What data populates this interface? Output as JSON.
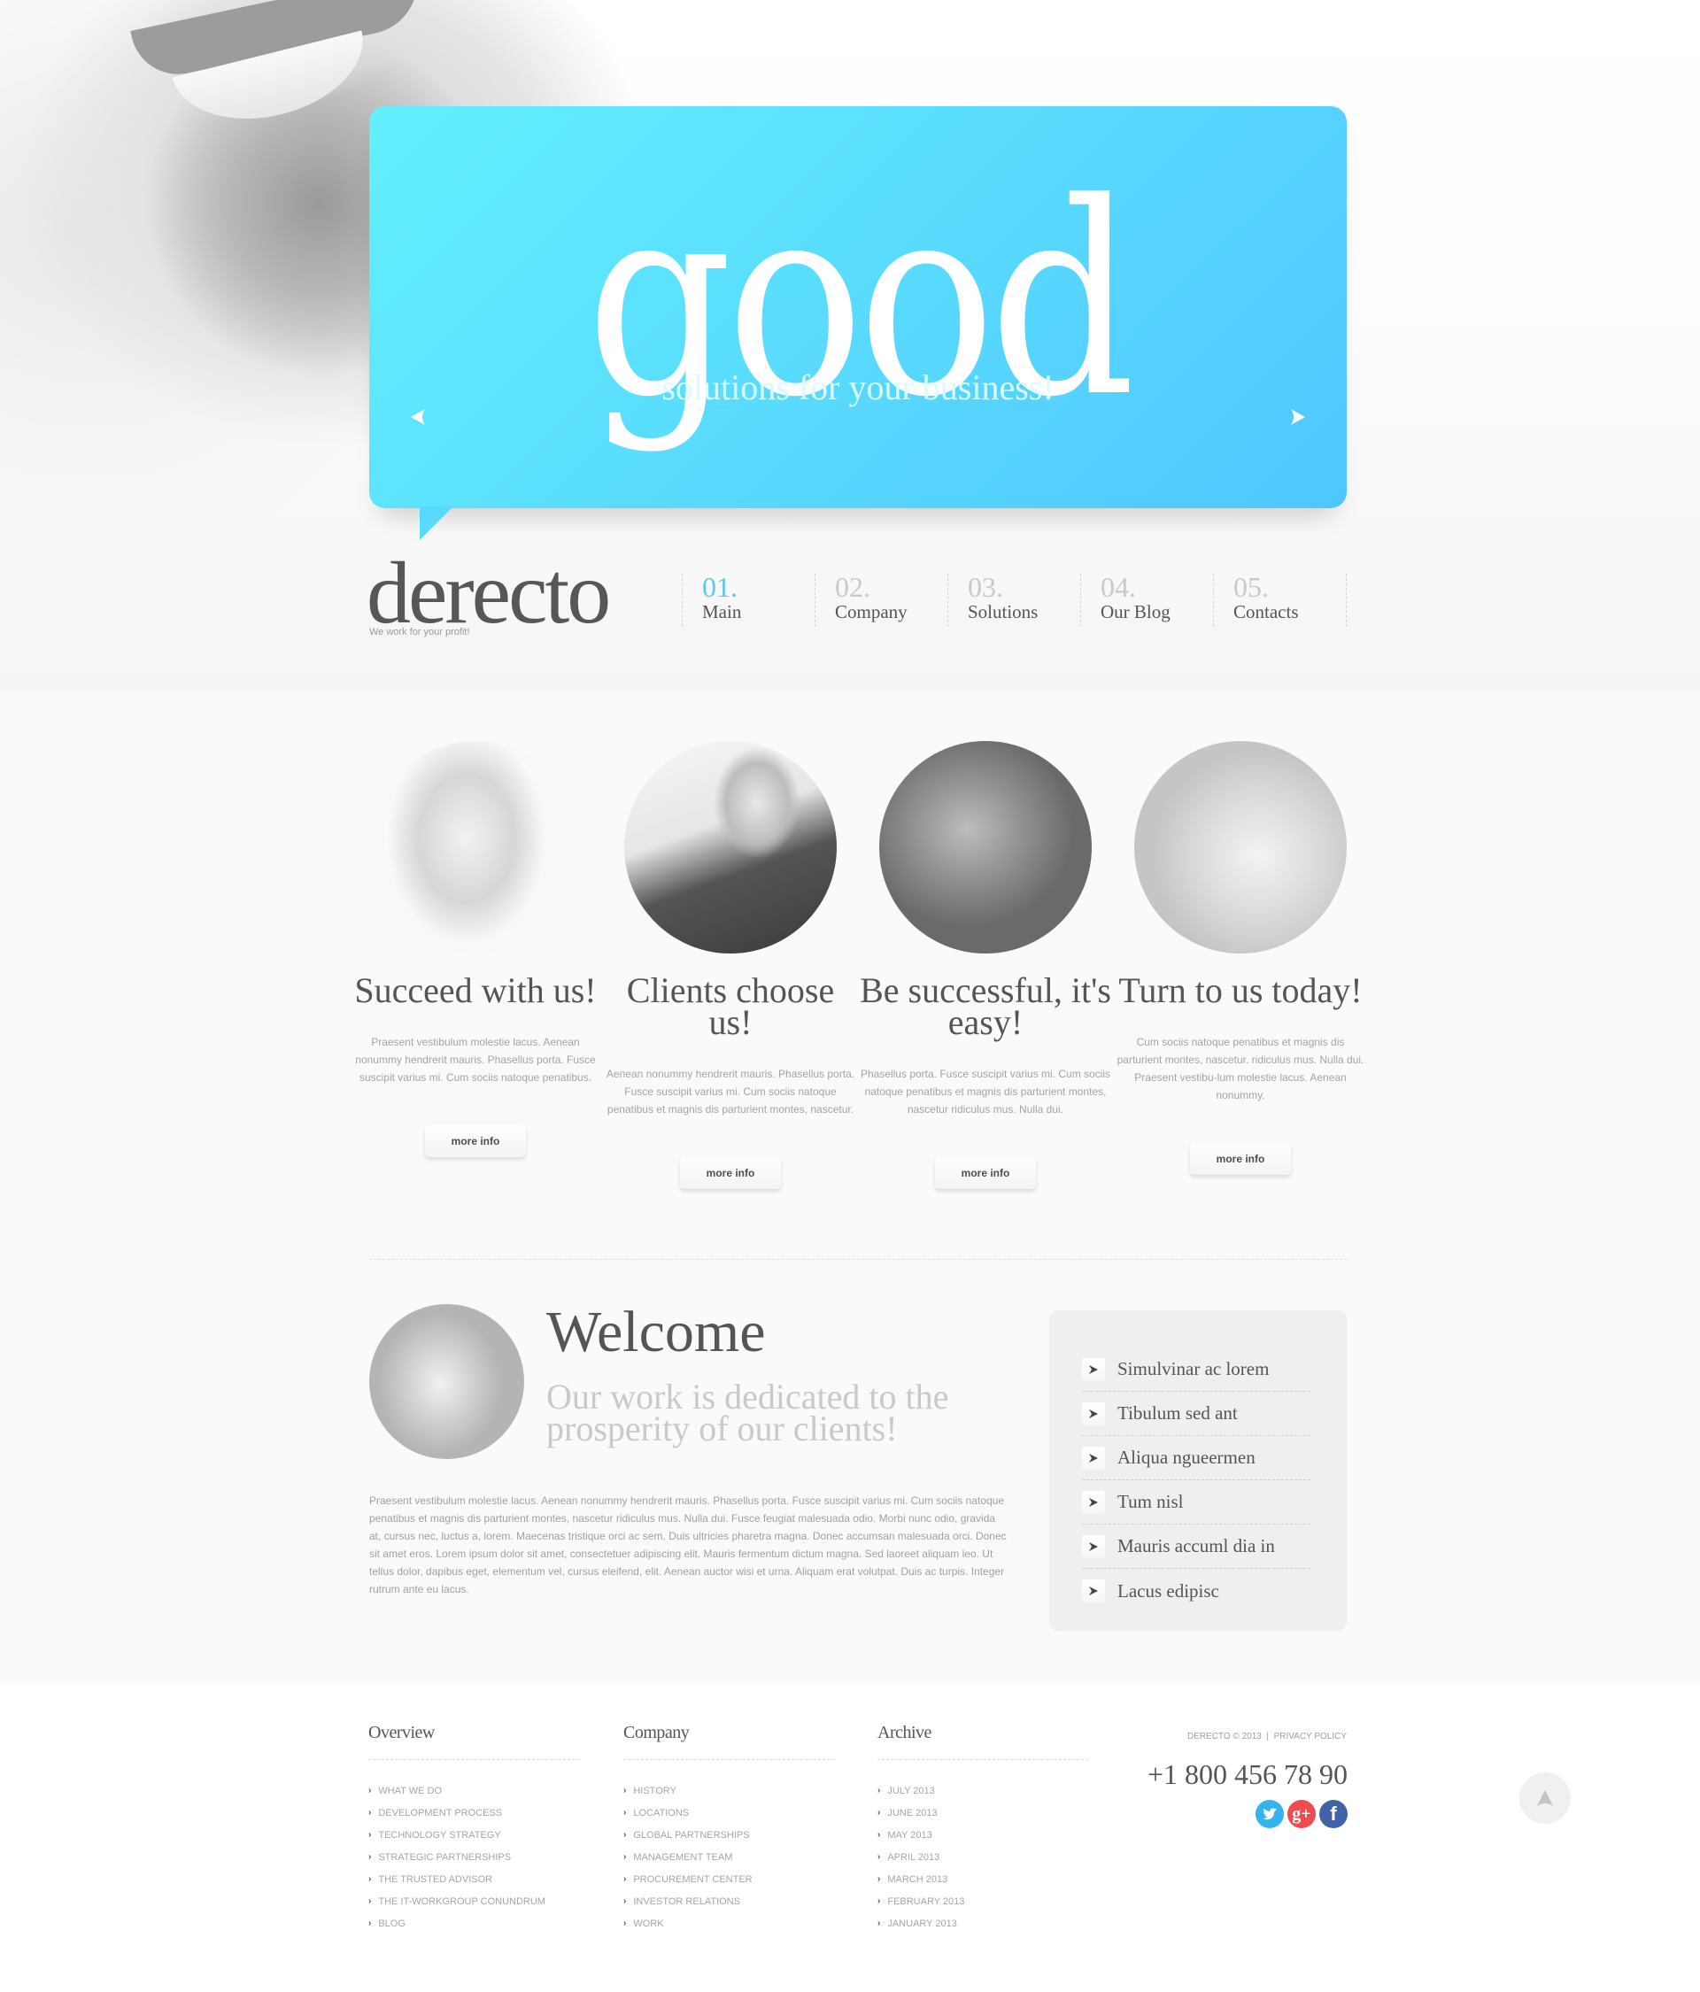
{
  "hero": {
    "headline": "good",
    "subline": "solutions for your business!",
    "colors": {
      "gradient_start": "#63f0fd",
      "gradient_end": "#4fc6ff"
    }
  },
  "brand": {
    "logo": "derecto",
    "tagline": "We work for your profit!"
  },
  "nav": {
    "active_color": "#5cc9ee",
    "items": [
      {
        "num": "01.",
        "label": "Main",
        "active": true
      },
      {
        "num": "02.",
        "label": "Company",
        "active": false
      },
      {
        "num": "03.",
        "label": "Solutions",
        "active": false
      },
      {
        "num": "04.",
        "label": "Our Blog",
        "active": false
      },
      {
        "num": "05.",
        "label": "Contacts",
        "active": false
      }
    ]
  },
  "features": [
    {
      "title": "Succeed with us!",
      "text": "Praesent vestibulum molestie lacus. Aenean nonummy hendrerit mauris. Phasellus porta. Fusce suscipit varius mi. Cum sociis natoque penatibus.",
      "button": "more info"
    },
    {
      "title": "Clients choose us!",
      "text": "Aenean nonummy hendrerit mauris. Phasellus porta. Fusce suscipit varius mi. Cum sociis natoque penatibus et magnis dis parturient montes, nascetur.",
      "button": "more info"
    },
    {
      "title": "Be successful, it's easy!",
      "text": "Phasellus porta. Fusce suscipit varius mi. Cum sociis natoque penatibus et magnis dis parturient montes, nascetur ridiculus mus. Nulla dui.",
      "button": "more info"
    },
    {
      "title": "Turn to us today!",
      "text": "Cum sociis natoque penatibus et magnis dis parturient montes, nascetur. ridiculus mus. Nulla dui. Praesent vestibu-lum molestie lacus. Aenean nonummy.",
      "button": "more info"
    }
  ],
  "welcome": {
    "title": "Welcome",
    "subtitle": "Our work is dedicated to the prosperity of our clients!",
    "body": "Praesent vestibulum molestie lacus. Aenean nonummy hendrerit mauris. Phasellus porta. Fusce suscipit varius mi. Cum sociis natoque penatibus et magnis dis parturient montes, nascetur ridiculus mus. Nulla dui. Fusce feugiat malesuada odio. Morbi nunc odio, gravida at, cursus nec, luctus a, lorem. Maecenas tristique orci ac sem. Duis ultricies pharetra magna. Donec accumsan malesuada orci. Donec sit amet eros.  Lorem ipsum dolor sit amet, consectetuer adipiscing elit. Mauris fermentum dictum magna. Sed laoreet aliquam leo. Ut tellus dolor, dapibus eget, elementum vel, cursus eleifend, elit. Aenean auctor wisi et urna. Aliquam erat volutpat. Duis ac turpis. Integer rutrum ante eu lacus."
  },
  "side_links": [
    "Simulvinar ac lorem",
    "Tibulum sed ant",
    "Aliqua ngueermen",
    "Tum nisl",
    "Mauris accuml dia in",
    "Lacus edipisc"
  ],
  "footer": {
    "columns": [
      {
        "heading": "Overview",
        "items": [
          "WHAT WE DO",
          "DEVELOPMENT PROCESS",
          "TECHNOLOGY STRATEGY",
          "STRATEGIC PARTNERSHIPS",
          "THE TRUSTED ADVISOR",
          "THE IT-WORKGROUP CONUNDRUM",
          "BLOG"
        ]
      },
      {
        "heading": "Company",
        "items": [
          "HISTORY",
          "LOCATIONS",
          "GLOBAL PARTNERSHIPS",
          "MANAGEMENT TEAM",
          "PROCUREMENT CENTER",
          "INVESTOR RELATIONS",
          "WORK"
        ]
      },
      {
        "heading": "Archive",
        "items": [
          "JULY 2013",
          "JUNE 2013",
          "MAY 2013",
          "APRIL 2013",
          "MARCH 2013",
          "FEBRUARY 2013",
          "JANUARY 2013"
        ]
      }
    ],
    "copyright": "DERECTO © 2013",
    "separator": "|",
    "privacy": "PRIVACY POLICY",
    "phone": "+1 800 456 78 90",
    "socials": [
      {
        "name": "twitter",
        "glyph": "t",
        "color": "#34b4ee"
      },
      {
        "name": "google-plus",
        "glyph": "g+",
        "color": "#ef4c4f"
      },
      {
        "name": "facebook",
        "glyph": "f",
        "color": "#3f63a6"
      }
    ]
  }
}
